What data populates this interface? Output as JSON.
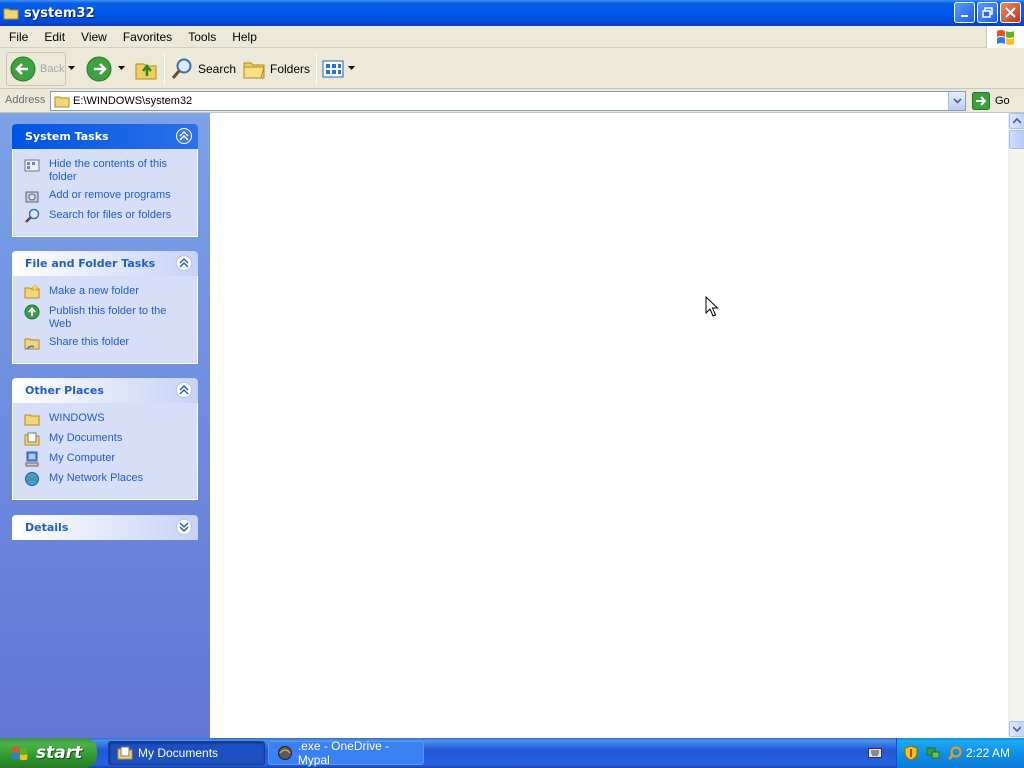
{
  "window": {
    "title": "system32"
  },
  "menubar": {
    "items": [
      "File",
      "Edit",
      "View",
      "Favorites",
      "Tools",
      "Help"
    ]
  },
  "toolbar": {
    "back_label": "Back",
    "search_label": "Search",
    "folders_label": "Folders"
  },
  "address": {
    "label": "Address",
    "path": "E:\\WINDOWS\\system32",
    "go_label": "Go"
  },
  "taskpane": {
    "system_tasks": {
      "title": "System Tasks",
      "items": [
        {
          "label": "Hide the contents of this folder",
          "icon": "hide-contents-icon"
        },
        {
          "label": "Add or remove programs",
          "icon": "add-remove-programs-icon"
        },
        {
          "label": "Search for files or folders",
          "icon": "search-icon"
        }
      ]
    },
    "file_folder_tasks": {
      "title": "File and Folder Tasks",
      "items": [
        {
          "label": "Make a new folder",
          "icon": "new-folder-icon"
        },
        {
          "label": "Publish this folder to the Web",
          "icon": "publish-web-icon"
        },
        {
          "label": "Share this folder",
          "icon": "share-folder-icon"
        }
      ]
    },
    "other_places": {
      "title": "Other Places",
      "items": [
        {
          "label": "WINDOWS",
          "icon": "folder-icon"
        },
        {
          "label": "My Documents",
          "icon": "my-documents-icon"
        },
        {
          "label": "My Computer",
          "icon": "my-computer-icon"
        },
        {
          "label": "My Network Places",
          "icon": "network-places-icon"
        }
      ]
    },
    "details": {
      "title": "Details"
    }
  },
  "taskbar": {
    "start_label": "start",
    "tasks": [
      {
        "label": "My Documents",
        "active": true
      },
      {
        "label": ".exe - OneDrive - Mypal",
        "active": false
      }
    ],
    "clock": "2:22 AM"
  },
  "colors": {
    "titlebar": "#0058ee",
    "taskpane": "#7ba2e7",
    "link": "#215dc6",
    "start": "#3c9a3c"
  }
}
